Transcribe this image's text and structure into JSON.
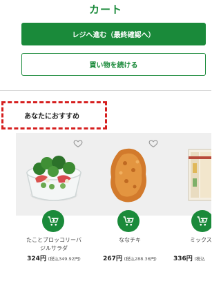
{
  "header": {
    "title": "カート"
  },
  "actions": {
    "checkout_label": "レジへ進む（最終確認へ）",
    "continue_label": "買い物を続ける"
  },
  "recommendations": {
    "heading": "あなたにおすすめ",
    "items": [
      {
        "name": "たことブロッコリーバジルサラダ",
        "price": "324円",
        "tax_price": "(税込349.92円)",
        "favorite_icon": "heart-outline-icon",
        "cart_icon": "add-to-cart-icon"
      },
      {
        "name": "ななチキ",
        "price": "267円",
        "tax_price": "(税込288.36円)",
        "favorite_icon": "heart-outline-icon",
        "cart_icon": "add-to-cart-icon"
      },
      {
        "name": "ミックスサ",
        "price": "336円",
        "tax_price": "(税込",
        "favorite_icon": "heart-outline-icon",
        "cart_icon": "add-to-cart-icon"
      }
    ]
  },
  "colors": {
    "brand_green": "#1a8a3a",
    "highlight_red": "#d61f1f"
  }
}
